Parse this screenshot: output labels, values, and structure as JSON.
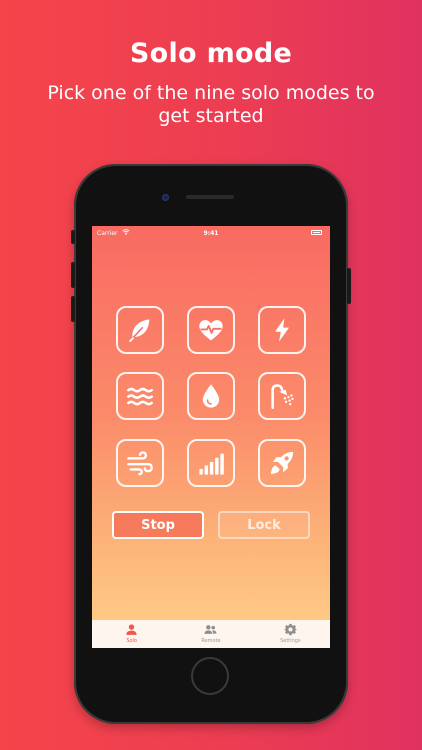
{
  "headline": "Solo mode",
  "subline": "Pick one of the nine solo modes to get started",
  "status_bar": {
    "carrier": "Carrier",
    "time": "9:41"
  },
  "modes": [
    {
      "icon": "feather-icon"
    },
    {
      "icon": "heartbeat-icon"
    },
    {
      "icon": "lightning-icon"
    },
    {
      "icon": "waves-icon"
    },
    {
      "icon": "water-drop-icon"
    },
    {
      "icon": "shower-icon"
    },
    {
      "icon": "wind-icon"
    },
    {
      "icon": "signal-bars-icon"
    },
    {
      "icon": "rocket-icon"
    }
  ],
  "actions": {
    "stop_label": "Stop",
    "lock_label": "Lock"
  },
  "tabs": [
    {
      "label": "Solo",
      "icon": "person-icon",
      "active": true
    },
    {
      "label": "Remote",
      "icon": "people-icon",
      "active": false
    },
    {
      "label": "Settings",
      "icon": "gear-icon",
      "active": false
    }
  ],
  "colors": {
    "background_left": "#f5454a",
    "background_right": "#e0325f",
    "screen_top": "#f96a62",
    "screen_bottom": "#fed18a",
    "active_tab": "#f2564c"
  }
}
